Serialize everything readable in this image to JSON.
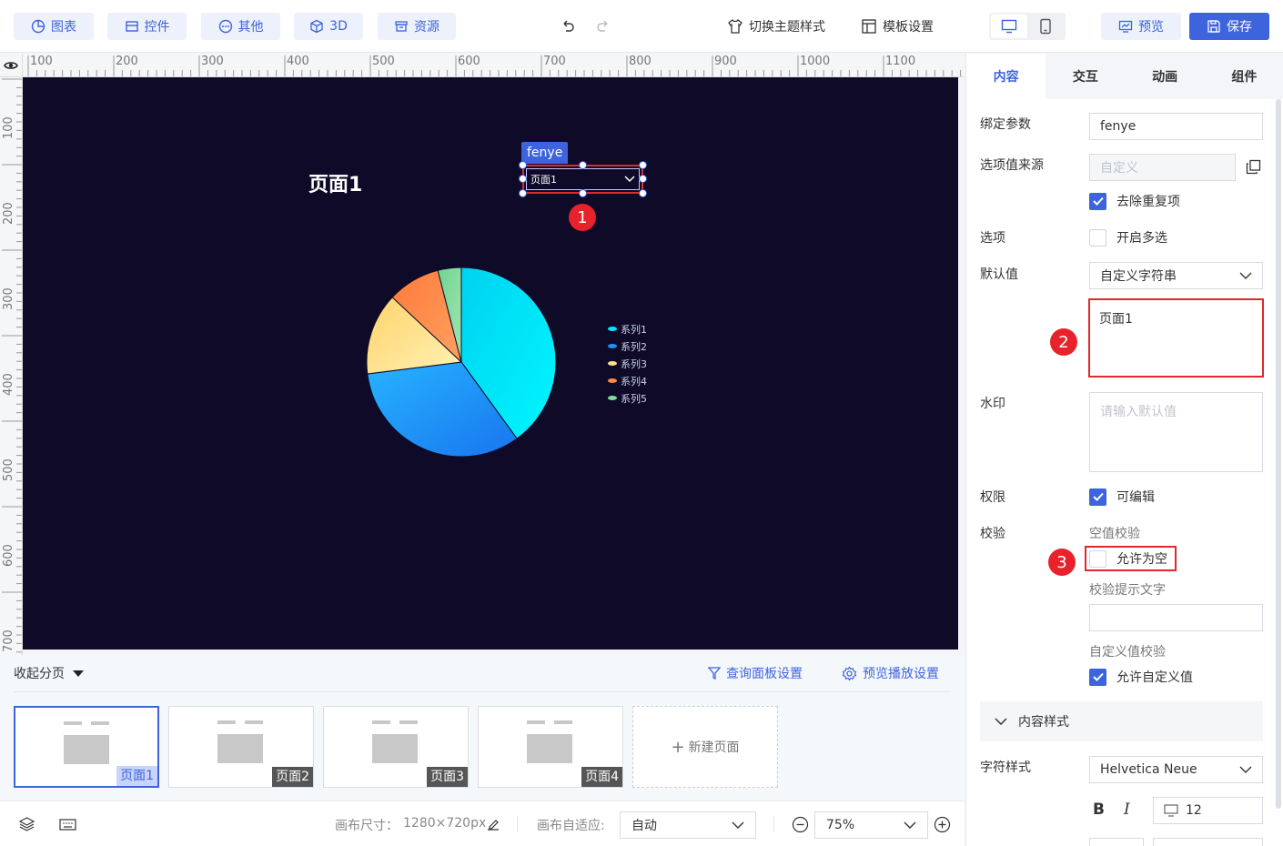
{
  "toolbar": {
    "chart": "图表",
    "control": "控件",
    "other": "其他",
    "three_d": "3D",
    "resource": "资源",
    "switch_theme": "切换主题样式",
    "template_settings": "模板设置",
    "preview": "预览",
    "save": "保存"
  },
  "ruler": {
    "top": [
      "100",
      "200",
      "300",
      "400",
      "500",
      "600",
      "700",
      "800",
      "900",
      "1000",
      "1100"
    ],
    "left": [
      "100",
      "200",
      "300",
      "400",
      "500",
      "600",
      "700"
    ]
  },
  "canvas": {
    "page_title": "页面1",
    "widget_tag": "fenye",
    "dropdown_value": "页面1",
    "background": "#0f0a28"
  },
  "badges": [
    "1",
    "2",
    "3"
  ],
  "chart_data": {
    "type": "pie",
    "title": "",
    "series": [
      {
        "name": "系列1",
        "value": 40,
        "color": "#00e8ff"
      },
      {
        "name": "系列2",
        "value": 33,
        "color": "#1e8ff8"
      },
      {
        "name": "系列3",
        "value": 14,
        "color": "#ffe08a"
      },
      {
        "name": "系列4",
        "value": 9,
        "color": "#ff8a45"
      },
      {
        "name": "系列5",
        "value": 4,
        "color": "#7fdc9f"
      }
    ],
    "legend_position": "right"
  },
  "pages": {
    "collapse_label": "收起分页",
    "query_panel": "查询面板设置",
    "preview_play": "预览播放设置",
    "items": [
      "页面1",
      "页面2",
      "页面3",
      "页面4"
    ],
    "new_page": "新建页面"
  },
  "footer": {
    "canvas_size_label": "画布尺寸：",
    "canvas_size": "1280×720px",
    "adapt_label": "画布自适应:",
    "adapt_value": "自动",
    "zoom": "75%"
  },
  "panel": {
    "tabs": [
      "内容",
      "交互",
      "动画",
      "组件"
    ],
    "bind_param_label": "绑定参数",
    "bind_param_value": "fenye",
    "option_source_label": "选项值来源",
    "option_source_value": "自定义",
    "dedupe_label": "去除重复项",
    "options_label": "选项",
    "multi_label": "开启多选",
    "default_label": "默认值",
    "default_type": "自定义字符串",
    "default_value": "页面1",
    "watermark_label": "水印",
    "watermark_placeholder": "请输入默认值",
    "permission_label": "权限",
    "editable_label": "可编辑",
    "validate_label": "校验",
    "empty_check": "空值校验",
    "allow_empty": "允许为空",
    "hint_text_label": "校验提示文字",
    "custom_check": "自定义值校验",
    "allow_custom": "允许自定义值",
    "content_style": "内容样式",
    "font_style_label": "字符样式",
    "font_value": "Helvetica Neue",
    "bold": "B",
    "italic": "I",
    "font_size": "12"
  }
}
